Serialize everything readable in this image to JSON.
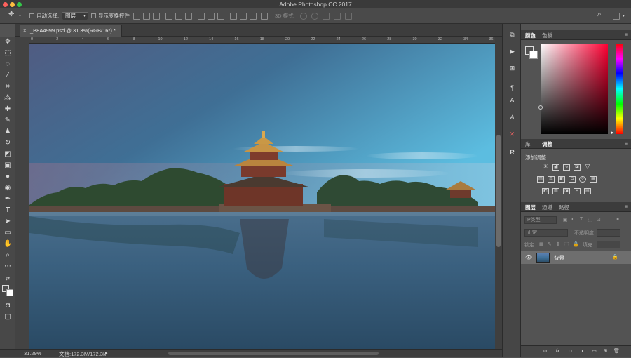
{
  "window": {
    "title": "Adobe Photoshop CC 2017"
  },
  "options_bar": {
    "auto_select_label": "自动选择:",
    "auto_select_value": "图层",
    "show_transform_label": "显示变换控件",
    "mode_3d_label": "3D 模式:"
  },
  "document": {
    "tab_label": "_B8A4999.psd @ 31.3%(RGB/16*) *",
    "close_glyph": "×"
  },
  "ruler": {
    "h_ticks": [
      "0",
      "2",
      "4",
      "6",
      "8",
      "10",
      "12",
      "14",
      "16",
      "18",
      "20",
      "22",
      "24",
      "26",
      "28",
      "30",
      "32",
      "34",
      "36"
    ]
  },
  "status": {
    "zoom": "31.29%",
    "doc_info": "文档:172.3M/172.3M"
  },
  "color_panel": {
    "tabs": [
      "颜色",
      "色板"
    ],
    "hue_marker_glyph": "▸",
    "colors": {
      "gradient_end": "#ff0033"
    }
  },
  "adjustments_panel": {
    "tabs": [
      "库",
      "调整"
    ],
    "add_label": "添加调整"
  },
  "layers_panel": {
    "tabs": [
      "图层",
      "通道",
      "路径"
    ],
    "filter_kind": "P类型",
    "blend_mode": "正常",
    "opacity_label": "不透明度:",
    "lock_label": "锁定:",
    "fill_label": "填充:",
    "layer_name": "背景"
  },
  "menu_glyph": "≡"
}
